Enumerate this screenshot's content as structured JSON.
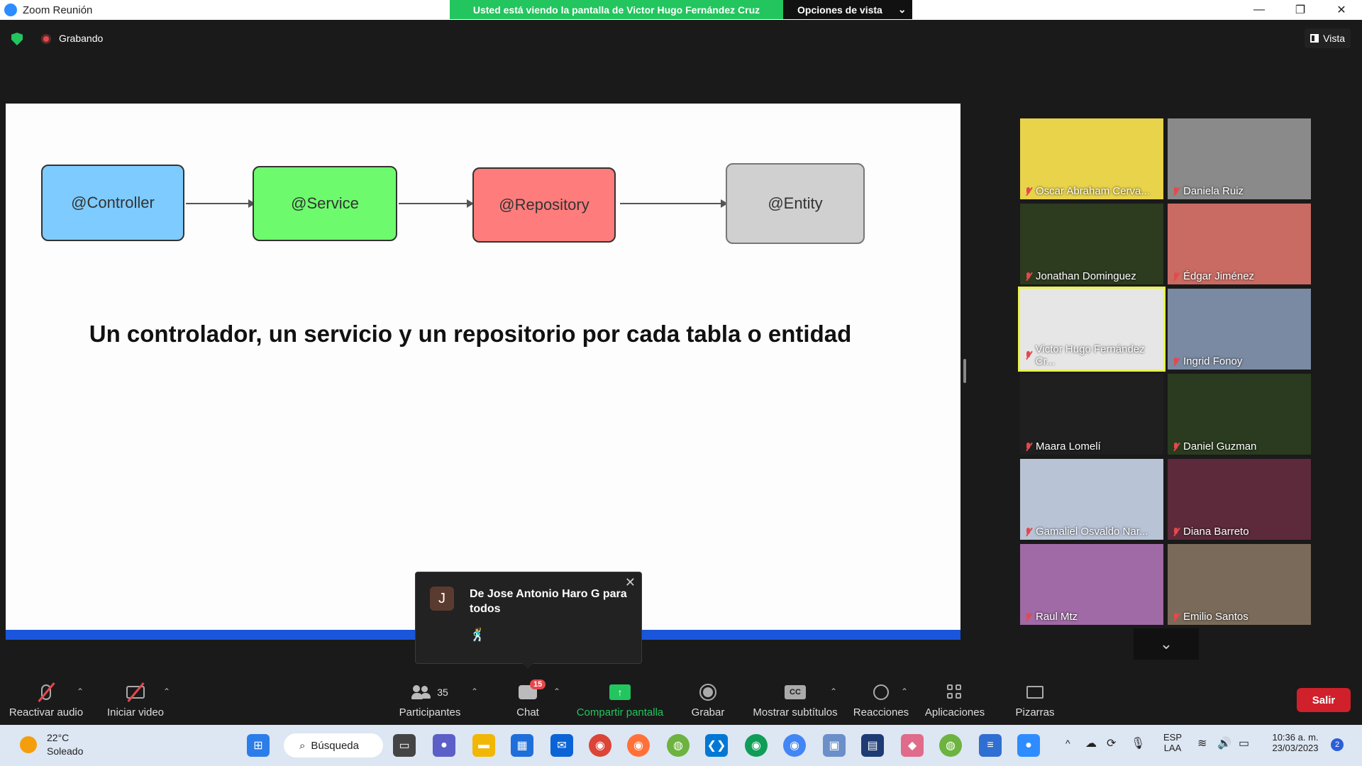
{
  "window": {
    "title": "Zoom Reunión"
  },
  "banner": {
    "text": "Usted está viendo la pantalla de Victor Hugo Fernández Cruz",
    "options_label": "Opciones de vista"
  },
  "status": {
    "recording_label": "Grabando",
    "view_label": "Vista"
  },
  "slide": {
    "boxes": [
      {
        "label": "@Controller",
        "color": "#7ecbff"
      },
      {
        "label": "@Service",
        "color": "#6dfb6d"
      },
      {
        "label": "@Repository",
        "color": "#ff7c7c"
      },
      {
        "label": "@Entity",
        "color": "#d0d0d0"
      }
    ],
    "headline": "Un controlador, un servicio y un repositorio por cada tabla o entidad"
  },
  "gallery": {
    "participants": [
      {
        "name": "Oscar Abraham Cerva...",
        "bg": "#e8d34a"
      },
      {
        "name": "Daniela Ruiz",
        "bg": "#8a8a8a"
      },
      {
        "name": "Jonathan Dominguez",
        "bg": "#2d3b1f"
      },
      {
        "name": "Édgar Jiménez",
        "bg": "#c96b62"
      },
      {
        "name": "Victor Hugo Fernández Cr...",
        "bg": "#e6e6e6",
        "speaking": true
      },
      {
        "name": "Ingrid Fonoy",
        "bg": "#7a8aa3"
      },
      {
        "name": "Maara Lomelí",
        "bg": "#1f1f1f"
      },
      {
        "name": "Daniel Guzman",
        "bg": "#2a3b1f"
      },
      {
        "name": "Gamaliel Osvaldo Nar...",
        "bg": "#b8c3d6"
      },
      {
        "name": "Diana Barreto",
        "bg": "#5c2a3a"
      },
      {
        "name": "Raul Mtz",
        "bg": "#a06aa6"
      },
      {
        "name": "Emilio Santos",
        "bg": "#7a6a5a"
      }
    ]
  },
  "toast": {
    "avatar_letter": "J",
    "title": "De Jose Antonio Haro G para todos",
    "message": "🕺"
  },
  "toolbar": {
    "audio": "Reactivar audio",
    "video": "Iniciar video",
    "participants": "Participantes",
    "participants_count": "35",
    "chat": "Chat",
    "chat_badge": "15",
    "share": "Compartir pantalla",
    "record": "Grabar",
    "subtitles": "Mostrar subtítulos",
    "reactions": "Reacciones",
    "apps": "Aplicaciones",
    "whiteboards": "Pizarras",
    "leave": "Salir"
  },
  "taskbar": {
    "temp": "22°C",
    "condition": "Soleado",
    "search": "Búsqueda",
    "lang_top": "ESP",
    "lang_bottom": "LAA",
    "time": "10:36 a. m.",
    "date": "23/03/2023",
    "notif_count": "2"
  }
}
